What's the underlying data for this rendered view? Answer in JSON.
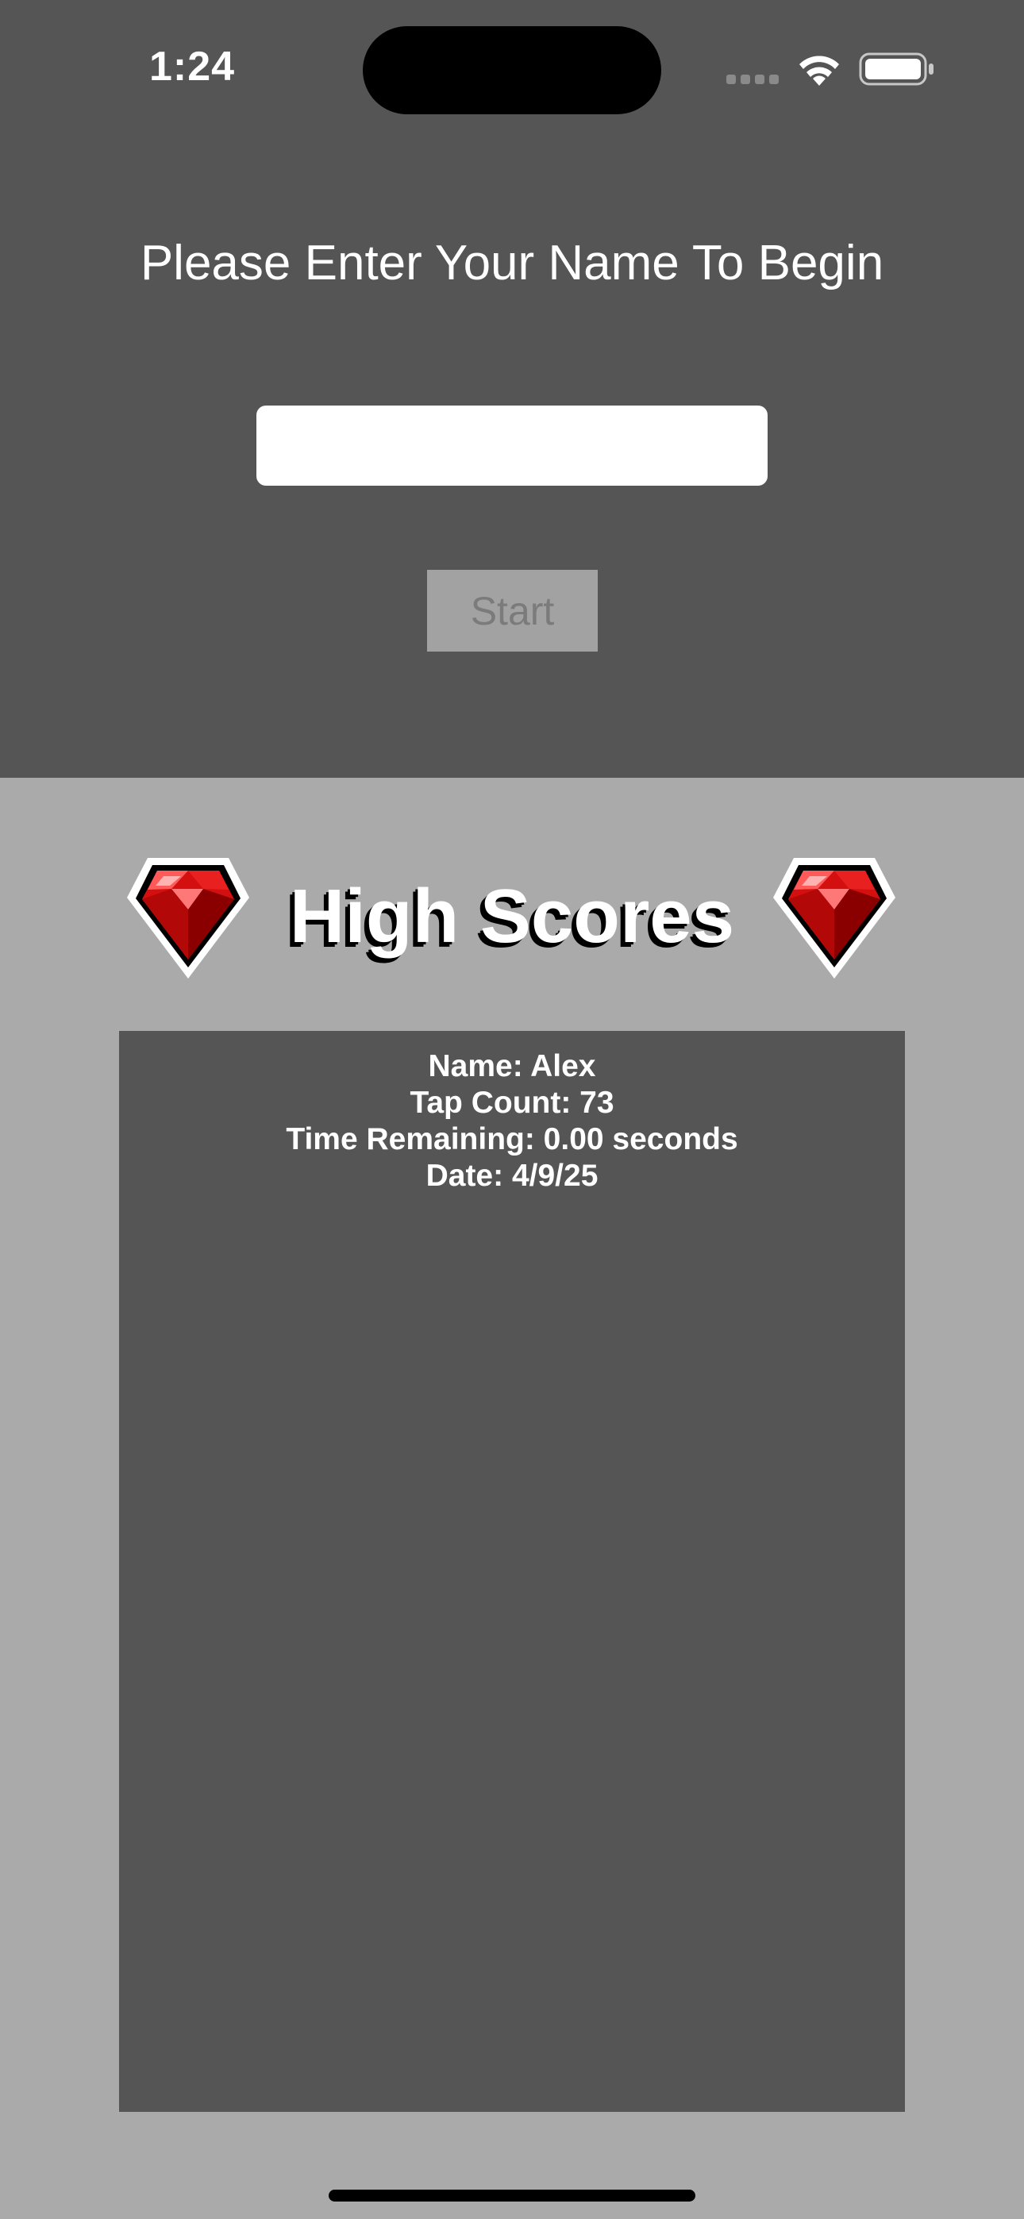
{
  "status_bar": {
    "time": "1:24"
  },
  "prompt": {
    "text": "Please Enter Your Name To Begin"
  },
  "name_field": {
    "value": "",
    "placeholder": ""
  },
  "start_button": {
    "label": "Start"
  },
  "high_scores": {
    "title": "High Scores",
    "entries": [
      {
        "name": "Name: Alex",
        "tap_count": "Tap Count: 73",
        "time_remaining": "Time Remaining: 0.00 seconds",
        "date": "Date: 4/9/25"
      }
    ]
  },
  "colors": {
    "top_background": "#555555",
    "bottom_background": "#aaaaaa",
    "panel_background": "#555555",
    "gem_red": "#e01010",
    "button_disabled": "#a2a2a2"
  },
  "icons": [
    "wifi-icon",
    "battery-icon",
    "cellular-signal-icon",
    "ruby-gem-icon"
  ]
}
